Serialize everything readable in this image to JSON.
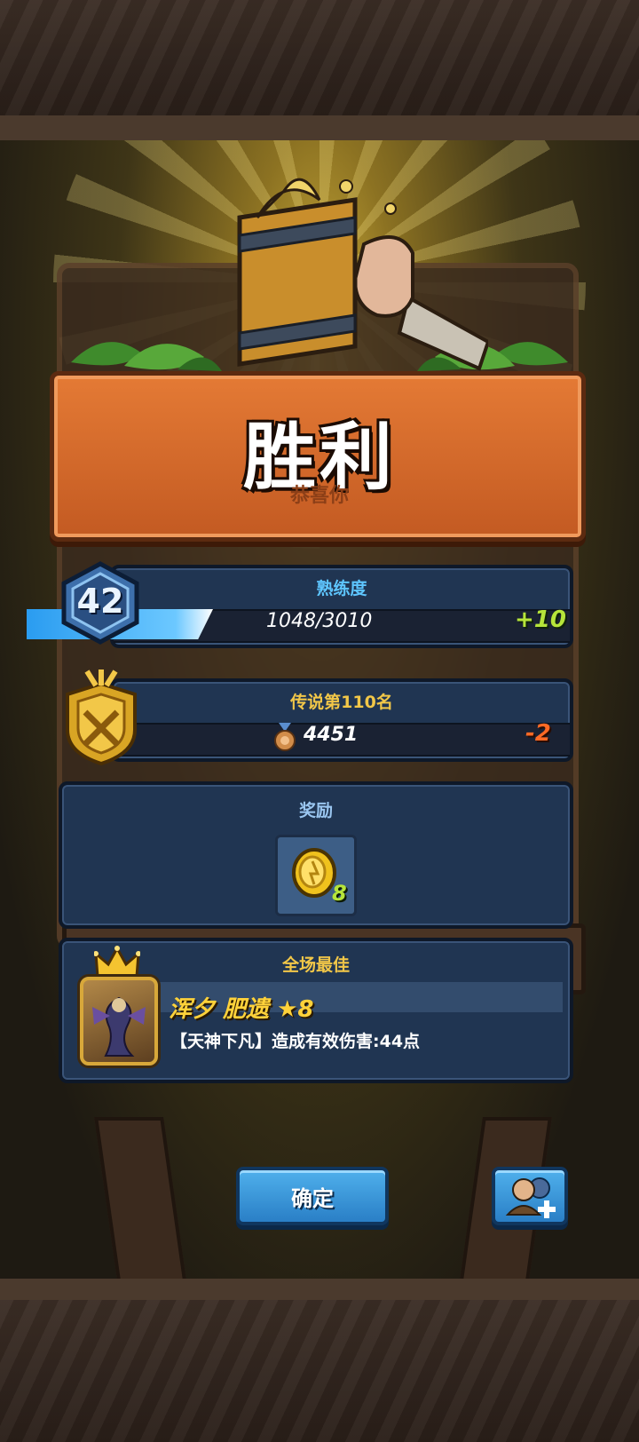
{
  "result": {
    "title": "胜利",
    "subtitle": "恭喜你"
  },
  "proficiency": {
    "label": "熟练度",
    "level": "42",
    "value": "1048/3010",
    "gain": "+10",
    "progress_fraction": 0.35
  },
  "rank": {
    "label": "传说第110名",
    "points": "4451",
    "delta": "-2"
  },
  "reward": {
    "label": "奖励",
    "items": [
      {
        "icon": "gold-coin-icon",
        "count": "8"
      }
    ]
  },
  "mvp": {
    "label": "全场最佳",
    "player": "浑夕 肥遗 ★8",
    "detail": "【天神下凡】造成有效伤害:44点"
  },
  "buttons": {
    "confirm": "确定",
    "add_friend_icon": "add-friend-icon"
  },
  "colors": {
    "title_plank": "#d96a2a",
    "panel_bg": "#203552",
    "gain_green": "#b6e53a",
    "loss_orange": "#ff6a25",
    "mvp_gold": "#ffd23a",
    "label_gold": "#f2c748",
    "label_blue": "#5ec6ff",
    "button_blue": "#3d98dc"
  }
}
